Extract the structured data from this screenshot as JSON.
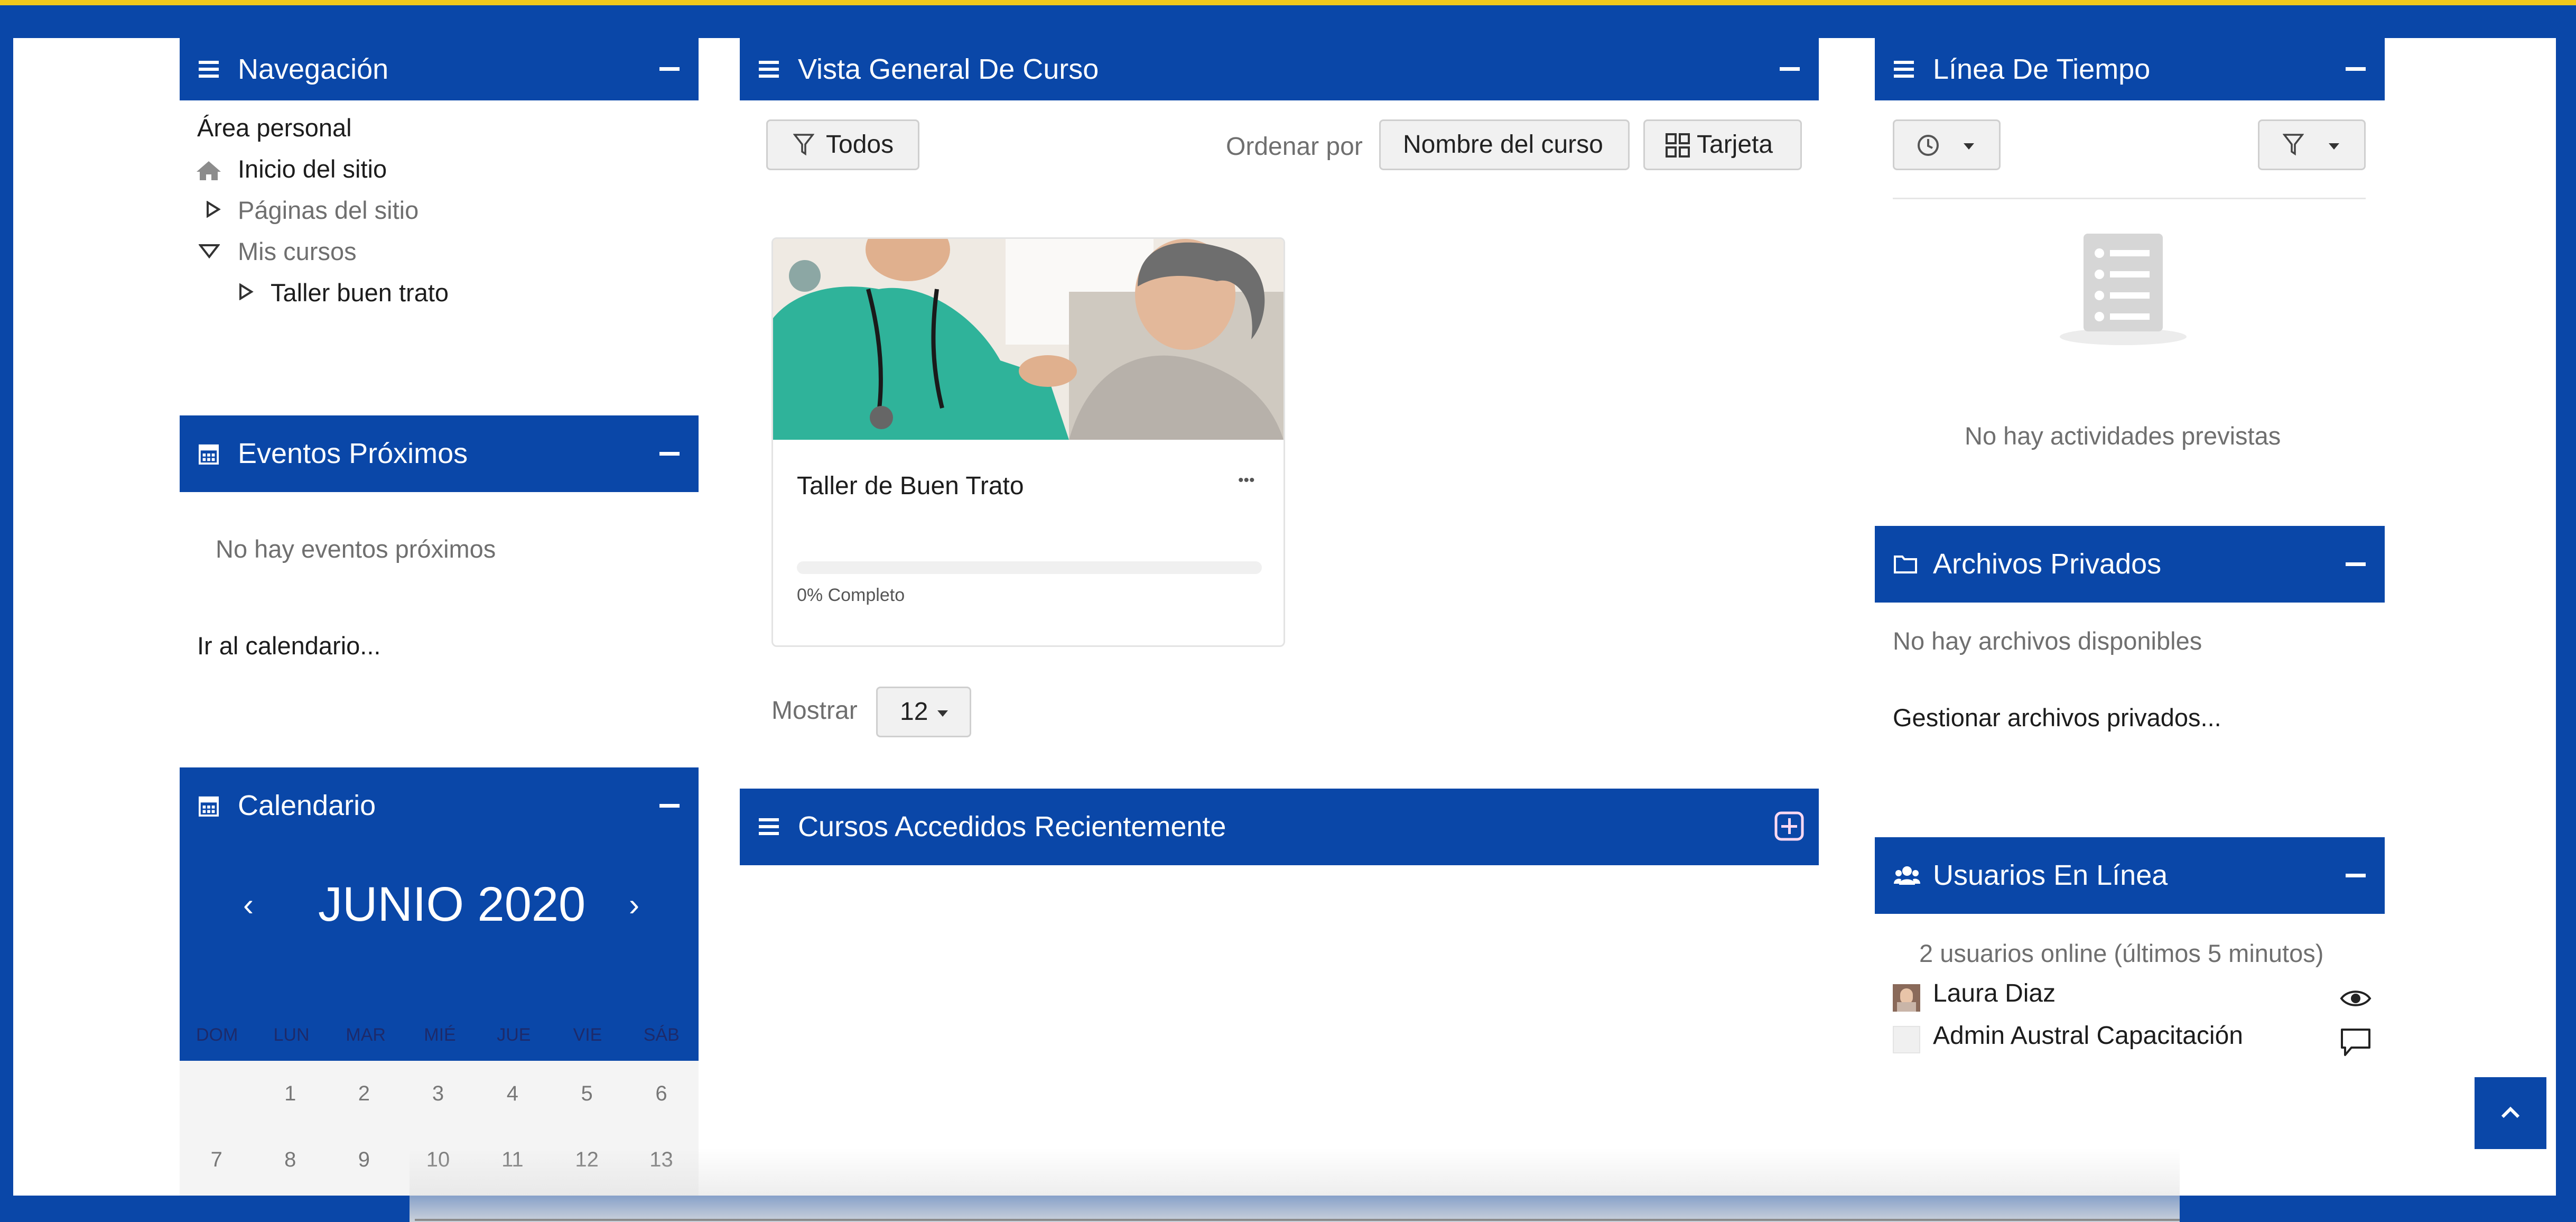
{
  "colors": {
    "brand": "#0a47a8",
    "accent": "#f2c81a",
    "page": "#ffffff",
    "muted_text": "#6f6f6f"
  },
  "navigation": {
    "title": "Navegación",
    "items": [
      {
        "label": "Área personal",
        "icon": ""
      },
      {
        "label": "Inicio del sitio",
        "icon": "home-icon"
      },
      {
        "label": "Páginas del sitio",
        "icon": "triangle-right-icon"
      },
      {
        "label": "Mis cursos",
        "icon": "triangle-down-icon"
      },
      {
        "label": "Taller buen trato",
        "icon": "triangle-right-icon"
      }
    ]
  },
  "events": {
    "title": "Eventos Próximos",
    "empty": "No hay eventos próximos",
    "link": "Ir al calendario..."
  },
  "calendar": {
    "title": "Calendario",
    "month": "JUNIO 2020",
    "prev": "‹",
    "next": "›",
    "weekdays": [
      "DOM",
      "LUN",
      "MAR",
      "MIÉ",
      "JUE",
      "VIE",
      "SÁB"
    ],
    "weeks": [
      [
        "",
        "1",
        "2",
        "3",
        "4",
        "5",
        "6"
      ],
      [
        "7",
        "8",
        "9",
        "10",
        "11",
        "12",
        "13"
      ]
    ]
  },
  "course_overview": {
    "title": "Vista General De Curso",
    "filter_label": "Todos",
    "sort_label": "Ordenar por",
    "sort_value": "Nombre del curso",
    "view_label": "Tarjeta",
    "course": {
      "name": "Taller de Buen Trato",
      "progress_label": "0% Completo",
      "progress_percent": 0,
      "menu": "•••"
    },
    "show_label": "Mostrar",
    "show_value": "12"
  },
  "recent_courses": {
    "title": "Cursos Accedidos Recientemente"
  },
  "timeline": {
    "title": "Línea De Tiempo",
    "empty": "No hay actividades previstas"
  },
  "private_files": {
    "title": "Archivos Privados",
    "empty": "No hay archivos disponibles",
    "link": "Gestionar archivos privados..."
  },
  "online_users": {
    "title": "Usuarios En Línea",
    "summary": "2 usuarios online (últimos 5 minutos)",
    "users": [
      {
        "name": "Laura Diaz",
        "action_icon": "eye-icon"
      },
      {
        "name": "Admin Austral Capacitación",
        "action_icon": "message-icon"
      }
    ]
  },
  "scroll_top": {
    "icon": "chevron-up-icon"
  }
}
